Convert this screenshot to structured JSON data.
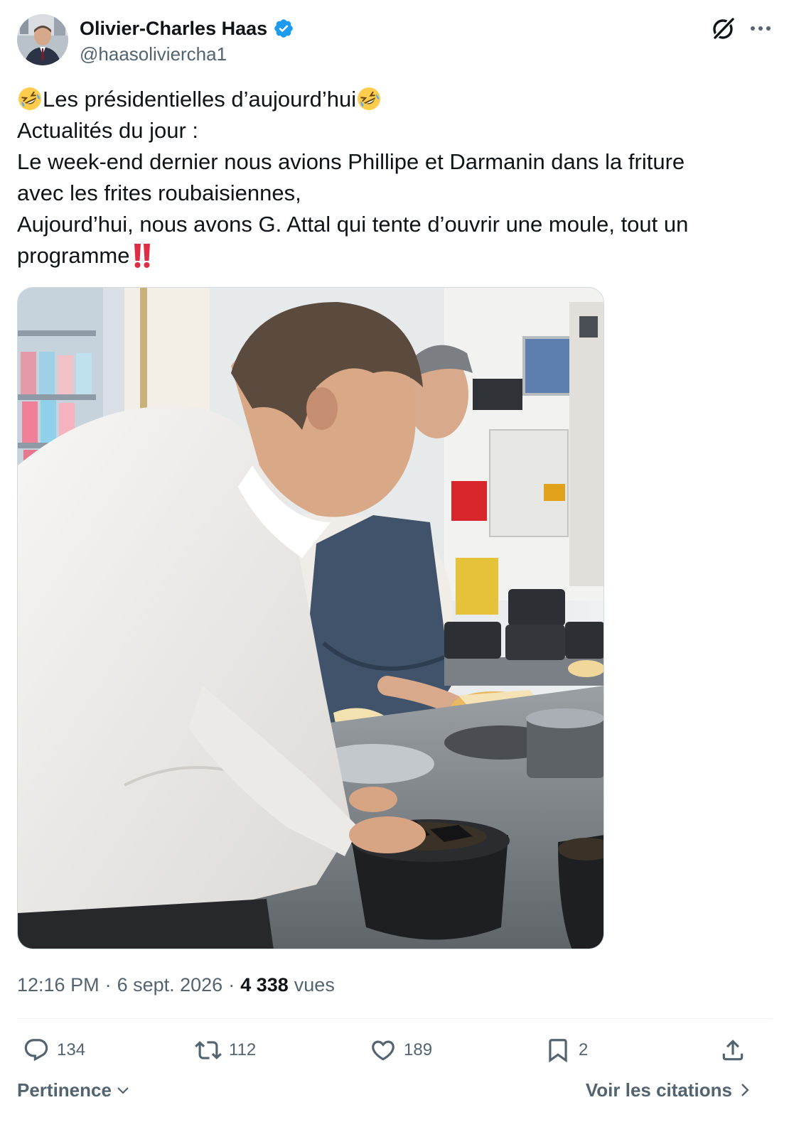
{
  "author": {
    "name": "Olivier-Charles Haas",
    "handle": "@haasoliviercha1",
    "verified": true,
    "verified_color": "#1d9bf0"
  },
  "header_icons": [
    "grok-icon",
    "more-icon"
  ],
  "tweet": {
    "lines": [
      "Les présidentielles d’aujourd’hui",
      "Actualités du jour :",
      "Le week-end dernier nous avions Phillipe et Darmanin dans la friture",
      "avec les frites roubaisiennes,",
      "Aujourd’hui, nous avons G. Attal qui tente d’ouvrir une moule, tout un",
      "programme"
    ],
    "emojis": [
      "rolling-on-floor-laughing",
      "double-exclamation-mark"
    ]
  },
  "meta": {
    "time": "12:16 PM",
    "date": "6 sept. 2026",
    "views_count": "4 338",
    "views_label": "vues",
    "separator": "·"
  },
  "actions": {
    "replies": "134",
    "reposts": "112",
    "likes": "189",
    "bookmarks": "2"
  },
  "footer": {
    "sort_label": "Pertinence",
    "quotes_label": "Voir les citations"
  },
  "colors": {
    "text_primary": "#0f1419",
    "text_secondary": "#536471",
    "border": "#eff3f4",
    "accent": "#1d9bf0"
  }
}
